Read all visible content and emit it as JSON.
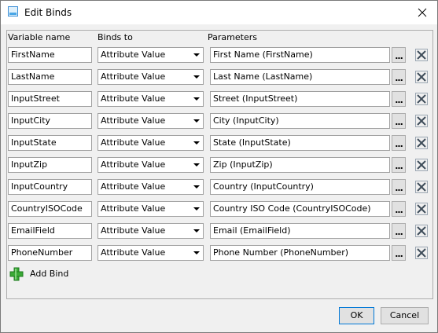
{
  "window": {
    "title": "Edit Binds",
    "close_icon": "close-icon"
  },
  "headers": {
    "variable_name": "Variable name",
    "binds_to": "Binds to",
    "parameters": "Parameters"
  },
  "rows": [
    {
      "variable": "FirstName",
      "binds_to": "Attribute Value",
      "parameter": "First Name (FirstName)",
      "browse": "..."
    },
    {
      "variable": "LastName",
      "binds_to": "Attribute Value",
      "parameter": "Last Name (LastName)",
      "browse": "..."
    },
    {
      "variable": "InputStreet",
      "binds_to": "Attribute Value",
      "parameter": "Street (InputStreet)",
      "browse": "..."
    },
    {
      "variable": "InputCity",
      "binds_to": "Attribute Value",
      "parameter": "City (InputCity)",
      "browse": "..."
    },
    {
      "variable": "InputState",
      "binds_to": "Attribute Value",
      "parameter": "State (InputState)",
      "browse": "..."
    },
    {
      "variable": "InputZip",
      "binds_to": "Attribute Value",
      "parameter": "Zip (InputZip)",
      "browse": "..."
    },
    {
      "variable": "InputCountry",
      "binds_to": "Attribute Value",
      "parameter": "Country (InputCountry)",
      "browse": "..."
    },
    {
      "variable": "CountryISOCode",
      "binds_to": "Attribute Value",
      "parameter": "Country ISO Code (CountryISOCode)",
      "browse": "..."
    },
    {
      "variable": "EmailField",
      "binds_to": "Attribute Value",
      "parameter": "Email (EmailField)",
      "browse": "..."
    },
    {
      "variable": "PhoneNumber",
      "binds_to": "Attribute Value",
      "parameter": "Phone Number (PhoneNumber)",
      "browse": "..."
    }
  ],
  "add_bind": {
    "label": "Add Bind",
    "icon": "plus-icon"
  },
  "footer": {
    "ok_label": "OK",
    "cancel_label": "Cancel"
  },
  "colors": {
    "focus_border": "#0078d7",
    "add_icon_green": "#3aa935",
    "delete_icon_border": "#5a6b7a"
  }
}
